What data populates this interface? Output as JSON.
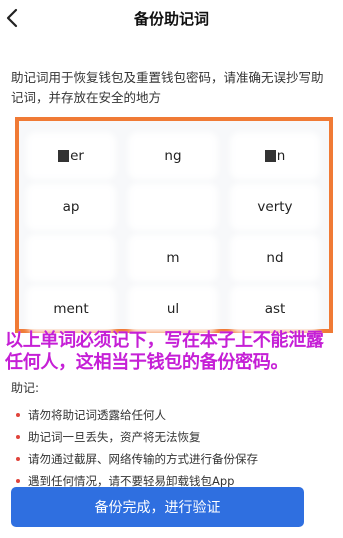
{
  "header": {
    "title": "备份助记词"
  },
  "description": "助记词用于恢复钱包及重置钱包密码，请准确无误抄写助记词，并存放在安全的地方",
  "mnemonic": {
    "words": [
      "er",
      "ng",
      "n",
      "ap",
      "",
      "verty",
      "",
      "m",
      "nd",
      "ment",
      "ul",
      "ast"
    ]
  },
  "annotation": "以上单词必须记下，写在本子上不能泄露任何人，这相当于钱包的备份密码。",
  "tips": {
    "title": "助记:",
    "items": [
      "请勿将助记词透露给任何人",
      "助记词一旦丢失，资产将无法恢复",
      "请勿通过截屏、网络传输的方式进行备份保存",
      "遇到任何情况，请不要轻易卸载钱包App"
    ]
  },
  "confirm_button": {
    "label": "备份完成，进行验证"
  },
  "colors": {
    "accent": "#2f6fe0",
    "frame": "#f07a35",
    "annotation": "#c51fd6",
    "bullet": "#e0443c"
  },
  "icons": {
    "back": "chevron-left-icon"
  }
}
